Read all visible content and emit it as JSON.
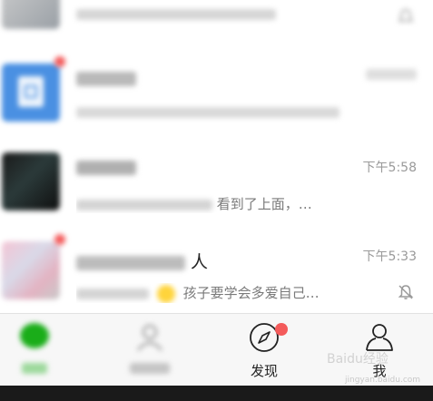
{
  "chats": [
    {
      "name": "",
      "preview": "",
      "time": ""
    },
    {
      "name": "",
      "preview": "",
      "time": ""
    },
    {
      "name": "",
      "preview": "看到了上面，…",
      "time": "下午5:58"
    },
    {
      "name": "人",
      "preview": "孩子要学会多爱自己…",
      "time": "下午5:33",
      "muted": true
    }
  ],
  "tabs": [
    {
      "label": "",
      "icon": "chat-icon"
    },
    {
      "label": "",
      "icon": "contacts-icon"
    },
    {
      "label": "发现",
      "icon": "compass-icon",
      "badge": true
    },
    {
      "label": "我",
      "icon": "person-icon"
    }
  ],
  "watermark": {
    "text": "Baidu经验",
    "url_text": "jingyan.baidu.com"
  },
  "colors": {
    "badge": "#f45b5b",
    "accent": "#07c160",
    "blue_avatar": "#4a90e2"
  }
}
